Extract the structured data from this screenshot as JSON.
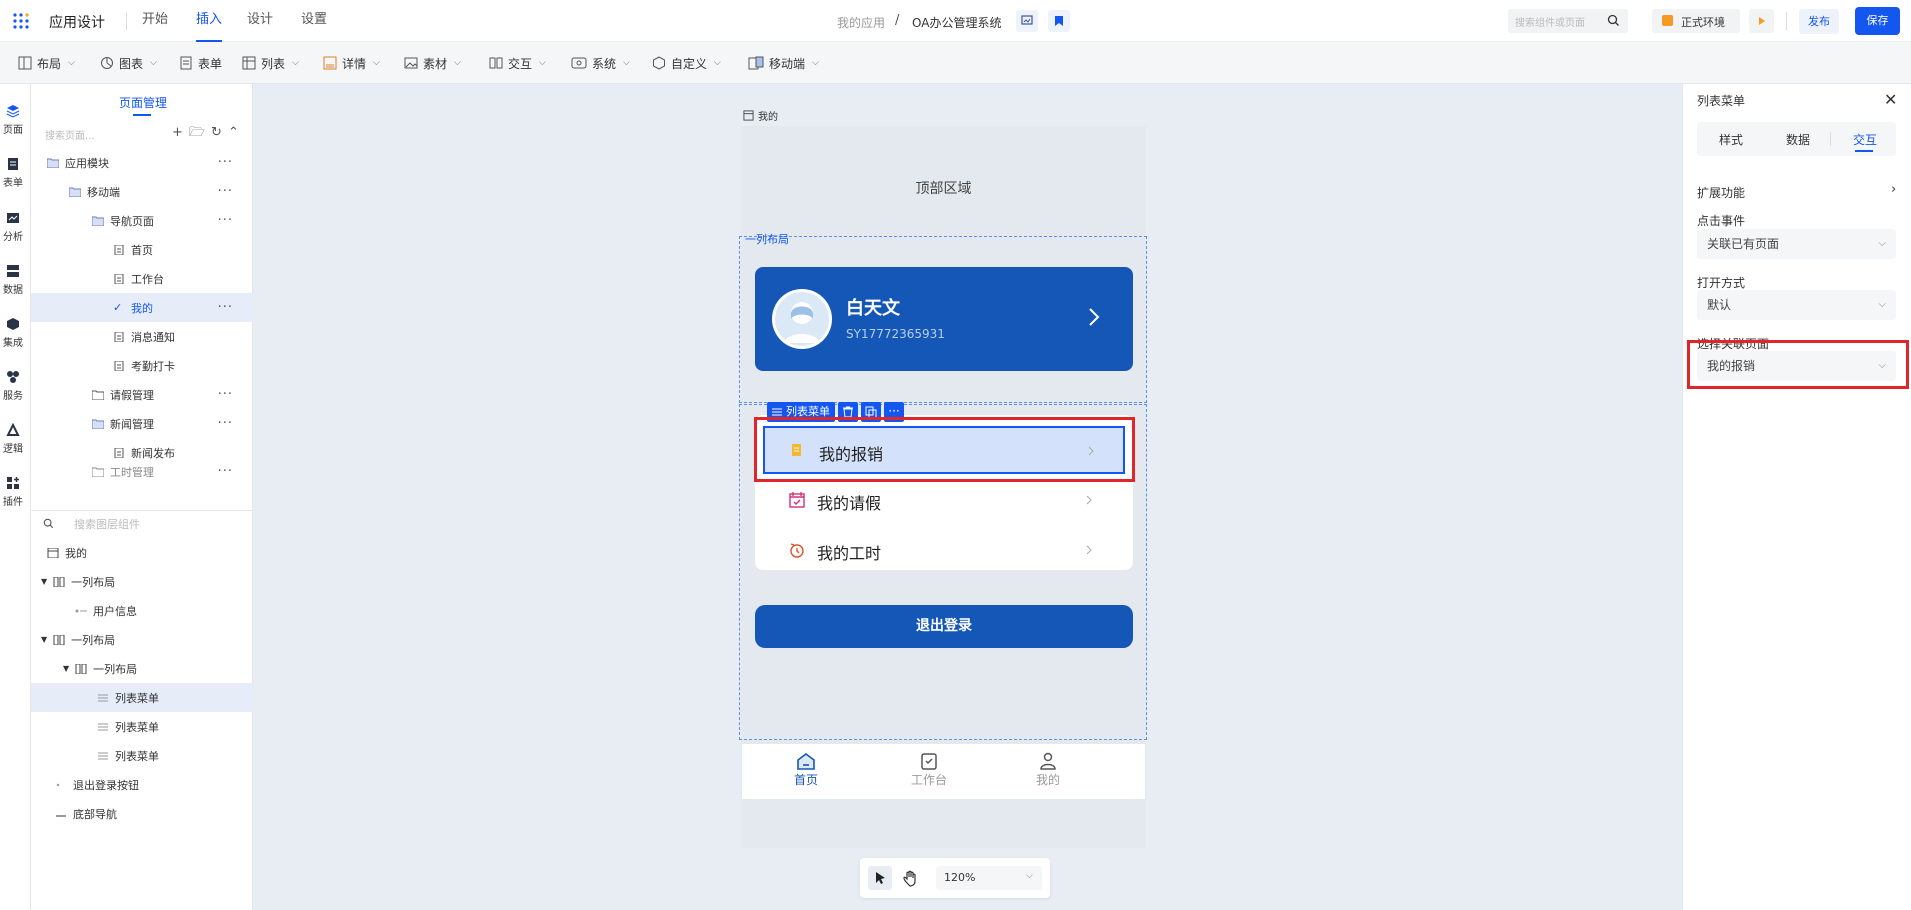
{
  "topbar": {
    "app_title": "应用设计",
    "nav": [
      "开始",
      "插入",
      "设计",
      "设置"
    ],
    "breadcrumb_app": "我的应用",
    "breadcrumb_sep": "/",
    "project_name": "OA办公管理系统",
    "search_placeholder": "搜索组件或页面",
    "env_label": "正式环境",
    "publish_label": "发布",
    "save_label": "保存"
  },
  "toolbar": {
    "items": [
      "布局",
      "图表",
      "表单",
      "列表",
      "详情",
      "素材",
      "交互",
      "系统",
      "自定义",
      "移动端"
    ]
  },
  "rail": {
    "items": [
      "页面",
      "表单",
      "分析",
      "数据",
      "集成",
      "服务",
      "逻辑",
      "插件"
    ]
  },
  "page_panel": {
    "tab": "页面管理",
    "search_placeholder": "搜索页面...",
    "tree": [
      "应用模块",
      "移动端",
      "导航页面",
      "首页",
      "工作台",
      "我的",
      "消息通知",
      "考勤打卡",
      "请假管理",
      "新闻管理",
      "新闻发布",
      "工时管理"
    ],
    "layer_search_placeholder": "搜索图层组件",
    "layers": [
      "我的",
      "一列布局",
      "用户信息",
      "一列布局",
      "一列布局",
      "列表菜单",
      "列表菜单",
      "列表菜单",
      "退出登录按钮",
      "底部导航"
    ]
  },
  "canvas": {
    "page_label": "我的",
    "top_area": "顶部区域",
    "layout_label": "一列布局",
    "user_name": "白天文",
    "user_id": "SY17772365931",
    "component_tag": "列表菜单",
    "menu": [
      "我的报销",
      "我的请假",
      "我的工时"
    ],
    "logout": "退出登录",
    "tabbar": [
      "首页",
      "工作台",
      "我的"
    ],
    "zoom": "120%"
  },
  "right_panel": {
    "title": "列表菜单",
    "tabs": [
      "样式",
      "数据",
      "交互"
    ],
    "ext_label": "扩展功能",
    "click_event_label": "点击事件",
    "click_event_value": "关联已有页面",
    "open_mode_label": "打开方式",
    "open_mode_value": "默认",
    "linked_page_label": "选择关联页面",
    "linked_page_value": "我的报销"
  },
  "colors": {
    "primary": "#1456f0",
    "card_blue": "#1557b6",
    "highlight_red": "#e0252b"
  }
}
